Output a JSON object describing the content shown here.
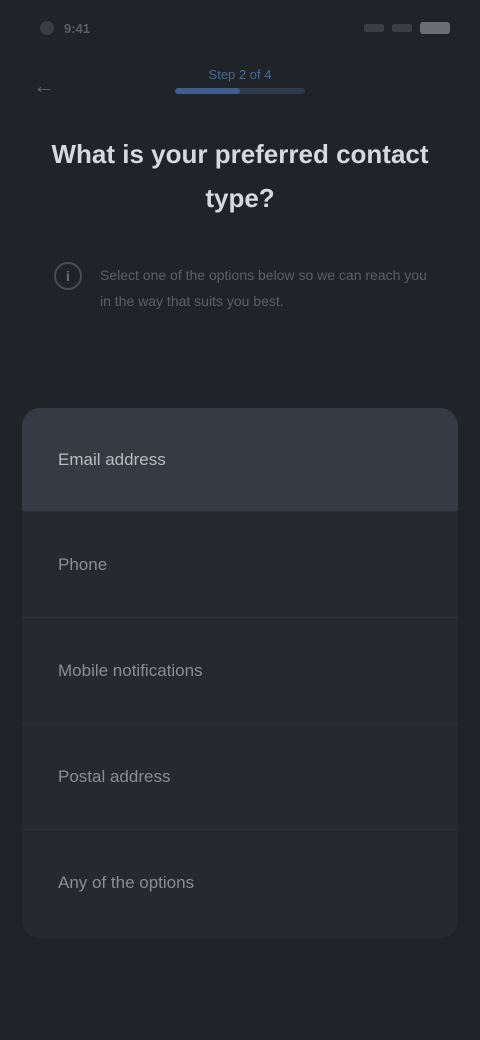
{
  "status": {
    "time": "9:41"
  },
  "header": {
    "step_label": "Step 2 of 4",
    "progress": 0.5,
    "title": "What is your preferred contact type?"
  },
  "info": {
    "text": "Select one of the options below so we can reach you in the way that suits you best."
  },
  "options": [
    {
      "label": "Email address",
      "selected": true
    },
    {
      "label": "Phone"
    },
    {
      "label": "Mobile notifications"
    },
    {
      "label": "Postal address"
    },
    {
      "label": "Any of the options"
    }
  ],
  "colors": {
    "background": "#202327",
    "card": "#26292e",
    "selected": "#363b43",
    "accent": "#3c5f8e"
  }
}
